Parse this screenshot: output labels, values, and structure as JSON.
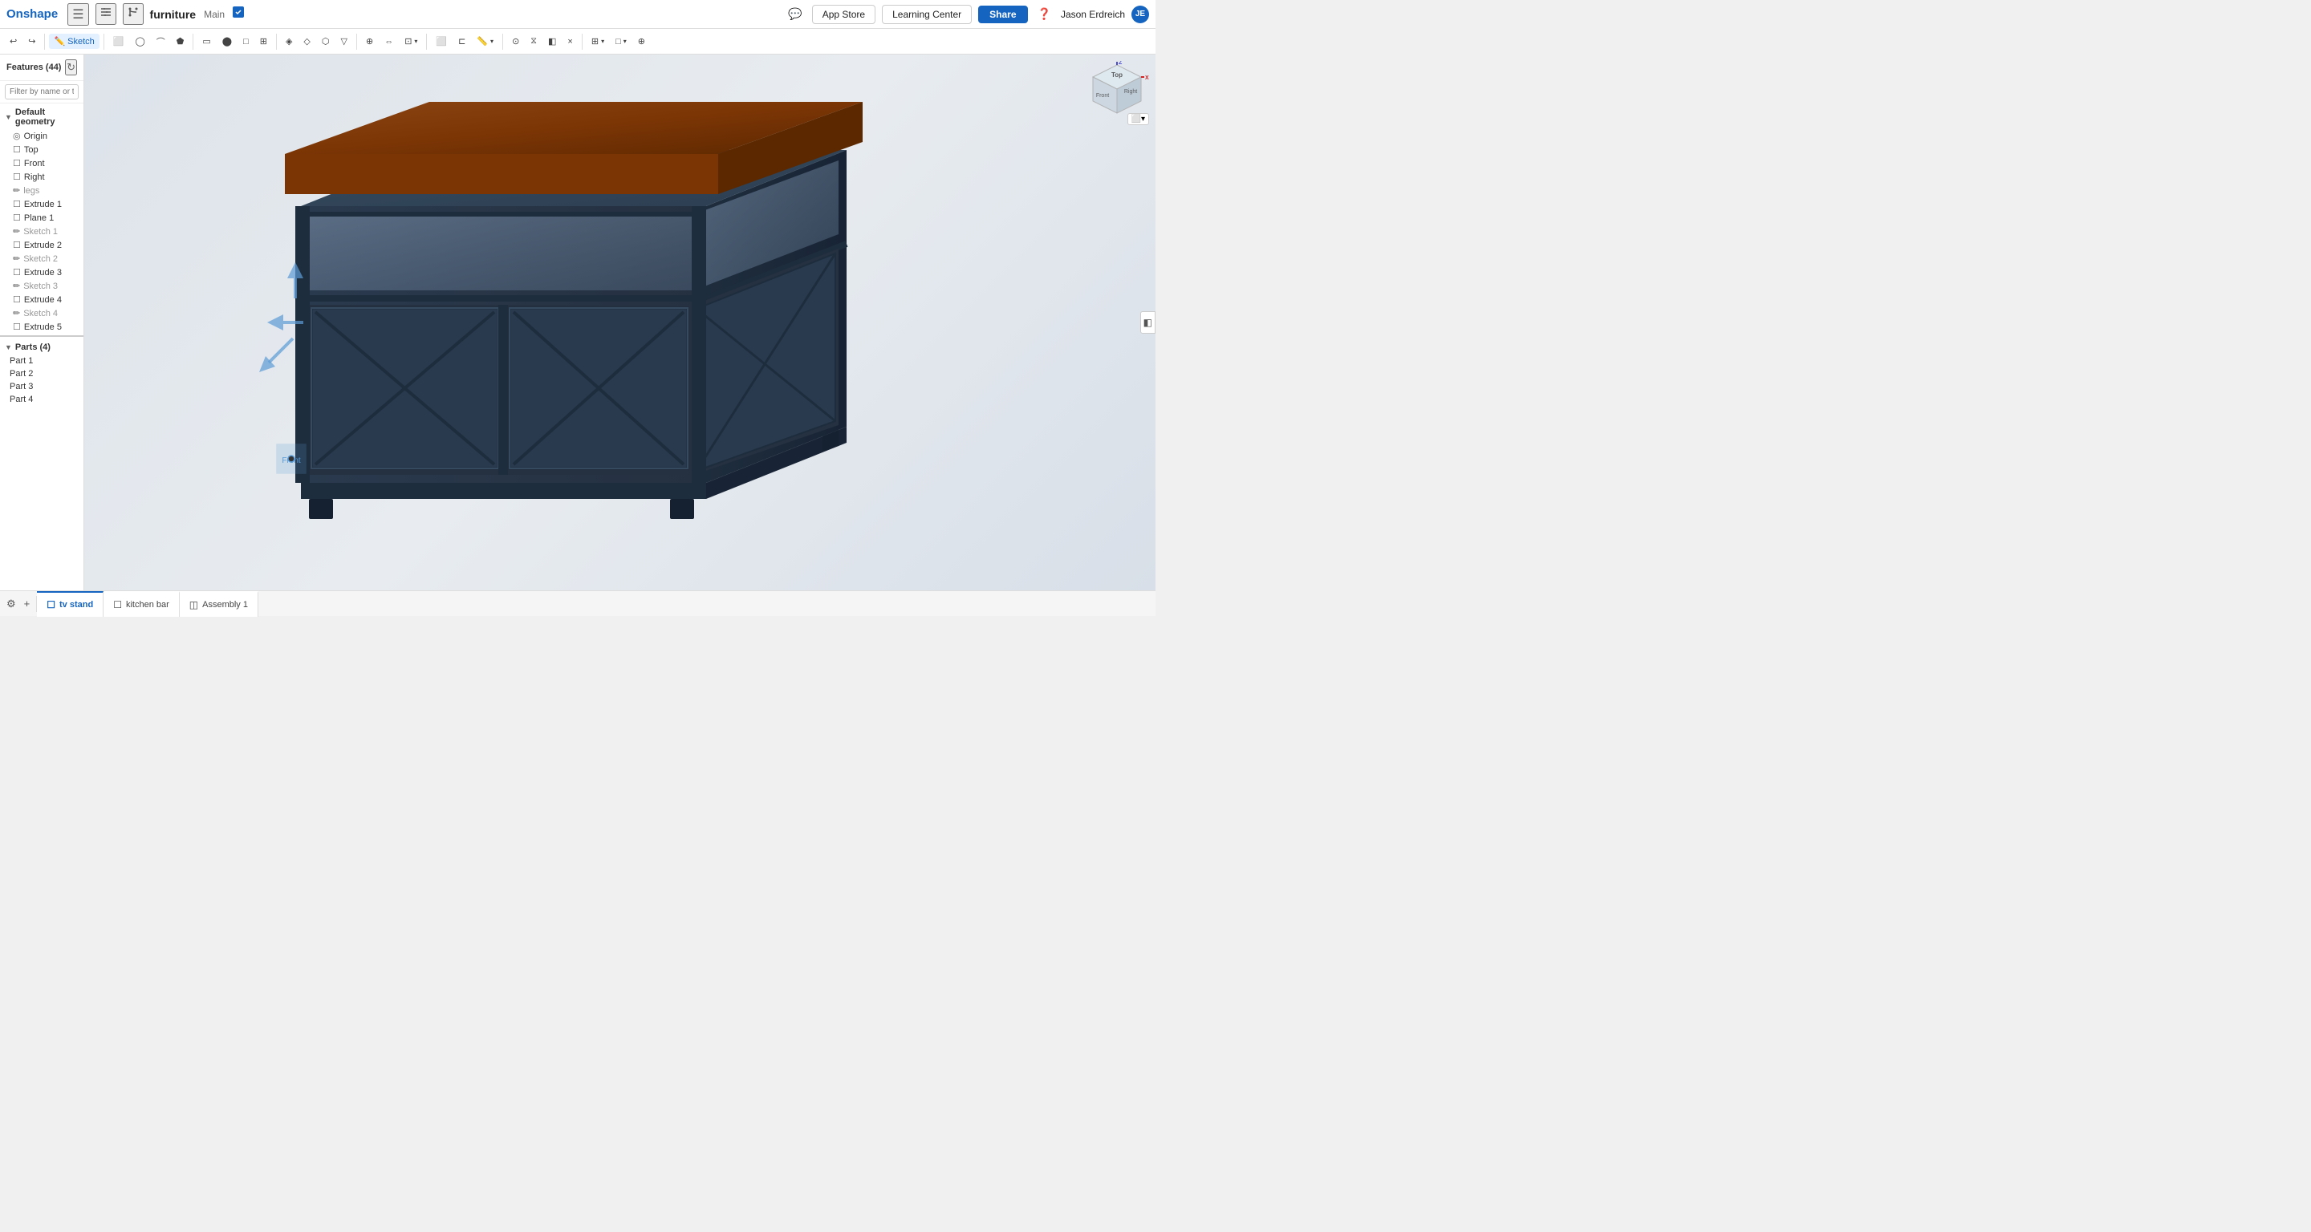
{
  "header": {
    "logo": "Onshape",
    "hamburger_label": "☰",
    "list_icon": "≡",
    "plus_icon": "+",
    "project_name": "furniture",
    "branch_name": "Main",
    "cloud_icon": "☁",
    "app_store_label": "App Store",
    "learning_center_label": "Learning Center",
    "share_label": "Share",
    "help_icon": "?",
    "user_name": "Jason Erdreich",
    "user_initials": "JE"
  },
  "toolbar": {
    "undo": "↩",
    "redo": "↪",
    "sketch_label": "Sketch",
    "tools": [
      "▭",
      "◯",
      "⌒",
      "⬟",
      "⬡",
      "□",
      "□",
      "⬜",
      "⬚",
      "⊞",
      "▤",
      "⊡",
      "⊕",
      "◈",
      "☰",
      "⊏",
      "⊐",
      "⊓",
      "⊒",
      "⊕",
      "⊗",
      "×",
      "□",
      "⊞"
    ]
  },
  "sidebar": {
    "title": "Features (44)",
    "refresh_icon": "↻",
    "search_placeholder": "Filter by name or type",
    "default_geometry_label": "Default geometry",
    "items": [
      {
        "name": "Origin",
        "icon": "◎",
        "type": "origin"
      },
      {
        "name": "Top",
        "icon": "☐",
        "type": "plane"
      },
      {
        "name": "Front",
        "icon": "☐",
        "type": "plane"
      },
      {
        "name": "Right",
        "icon": "☐",
        "type": "plane"
      },
      {
        "name": "legs",
        "icon": "✏",
        "type": "sketch"
      },
      {
        "name": "Extrude 1",
        "icon": "☐",
        "type": "extrude"
      },
      {
        "name": "Plane 1",
        "icon": "☐",
        "type": "plane"
      },
      {
        "name": "Sketch 1",
        "icon": "✏",
        "type": "sketch"
      },
      {
        "name": "Extrude 2",
        "icon": "☐",
        "type": "extrude"
      },
      {
        "name": "Sketch 2",
        "icon": "✏",
        "type": "sketch"
      },
      {
        "name": "Extrude 3",
        "icon": "☐",
        "type": "extrude"
      },
      {
        "name": "Sketch 3",
        "icon": "✏",
        "type": "sketch"
      },
      {
        "name": "Extrude 4",
        "icon": "☐",
        "type": "extrude"
      },
      {
        "name": "Sketch 4",
        "icon": "✏",
        "type": "sketch"
      },
      {
        "name": "Extrude 5",
        "icon": "☐",
        "type": "extrude"
      }
    ],
    "parts_label": "Parts (4)",
    "parts": [
      {
        "name": "Part 1"
      },
      {
        "name": "Part 2"
      },
      {
        "name": "Part 3"
      },
      {
        "name": "Part 4"
      }
    ]
  },
  "tabs": [
    {
      "label": "tv stand",
      "icon": "☐",
      "active": true,
      "type": "part"
    },
    {
      "label": "kitchen bar",
      "icon": "☐",
      "active": false,
      "type": "part"
    },
    {
      "label": "Assembly 1",
      "icon": "◫",
      "active": false,
      "type": "assembly"
    }
  ],
  "tab_controls": {
    "settings_icon": "⚙",
    "add_icon": "+"
  },
  "viewcube": {
    "top_label": "Top",
    "front_label": "Front",
    "right_label": "Right"
  },
  "colors": {
    "accent": "#1565c0",
    "wood_top": "#7B3F00",
    "cabinet_body": "#2d3a4a",
    "bg_gradient_start": "#dde3ea",
    "bg_gradient_end": "#d8dfe8"
  }
}
